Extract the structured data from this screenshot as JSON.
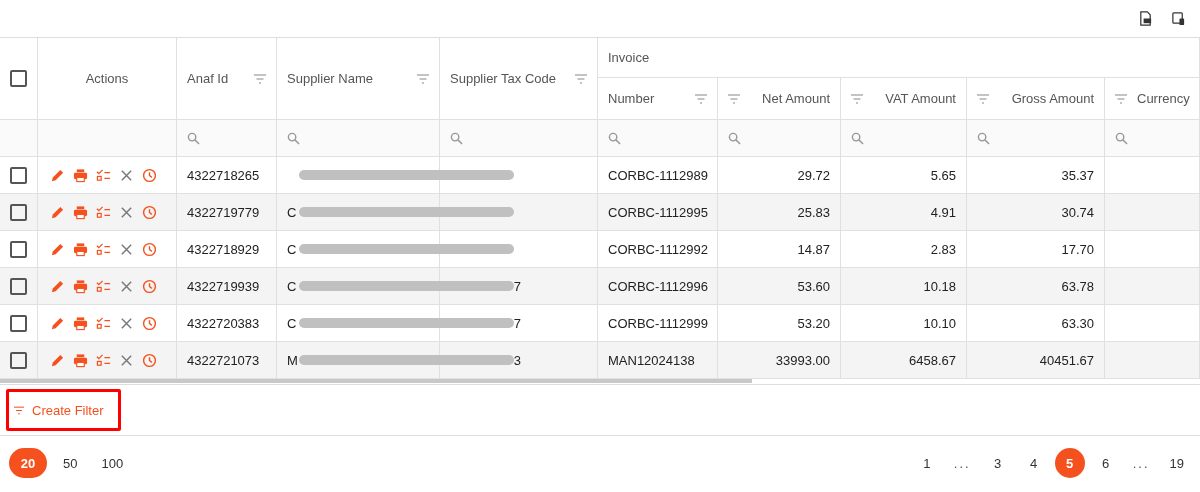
{
  "group_header": {
    "label": "Invoice"
  },
  "columns": [
    {
      "label": "Actions",
      "kind": "plain"
    },
    {
      "label": "Anaf Id",
      "kind": "text"
    },
    {
      "label": "Supplier Name",
      "kind": "text"
    },
    {
      "label": "Supplier Tax Code",
      "kind": "text"
    },
    {
      "label": "Number",
      "kind": "text"
    },
    {
      "label": "Net Amount",
      "kind": "amount"
    },
    {
      "label": "VAT Amount",
      "kind": "amount"
    },
    {
      "label": "Gross Amount",
      "kind": "amount"
    },
    {
      "label": "Currency",
      "kind": "amount"
    }
  ],
  "select_all": {
    "checked": false
  },
  "rows": [
    {
      "checked": false,
      "anaf_id": "4322718265",
      "number": "CORBC-1112989",
      "net": "29.72",
      "vat": "5.65",
      "gross": "35.37"
    },
    {
      "checked": false,
      "anaf_id": "4322719779",
      "supplier_name": "C",
      "number": "CORBC-1112995",
      "net": "25.83",
      "vat": "4.91",
      "gross": "30.74"
    },
    {
      "checked": false,
      "anaf_id": "4322718929",
      "supplier_name": "C",
      "number": "CORBC-1112992",
      "net": "14.87",
      "vat": "2.83",
      "gross": "17.70"
    },
    {
      "checked": false,
      "anaf_id": "4322719939",
      "supplier_name": "C",
      "supplier_tax_code": "7",
      "number": "CORBC-1112996",
      "net": "53.60",
      "vat": "10.18",
      "gross": "63.78"
    },
    {
      "checked": false,
      "anaf_id": "4322720383",
      "supplier_name": "C",
      "supplier_tax_code": "7",
      "number": "CORBC-1112999",
      "net": "53.20",
      "vat": "10.10",
      "gross": "63.30"
    },
    {
      "checked": false,
      "anaf_id": "4322721073",
      "supplier_name": "M",
      "supplier_tax_code": "3",
      "number": "MAN12024138",
      "net": "33993.00",
      "vat": "6458.67",
      "gross": "40451.67"
    }
  ],
  "create_filter": {
    "label": "Create Filter",
    "highlighted": true
  },
  "page_sizes": [
    {
      "label": "20",
      "selected": true
    },
    {
      "label": "50",
      "selected": false
    },
    {
      "label": "100",
      "selected": false
    }
  ],
  "pages": [
    {
      "label": "1",
      "selected": false,
      "kind": "page"
    },
    {
      "label": "...",
      "selected": false,
      "kind": "gap"
    },
    {
      "label": "3",
      "selected": false,
      "kind": "page"
    },
    {
      "label": "4",
      "selected": false,
      "kind": "page"
    },
    {
      "label": "5",
      "selected": true,
      "kind": "page"
    },
    {
      "label": "6",
      "selected": false,
      "kind": "page"
    },
    {
      "label": "...",
      "selected": false,
      "kind": "gap"
    },
    {
      "label": "19",
      "selected": false,
      "kind": "page"
    }
  ]
}
